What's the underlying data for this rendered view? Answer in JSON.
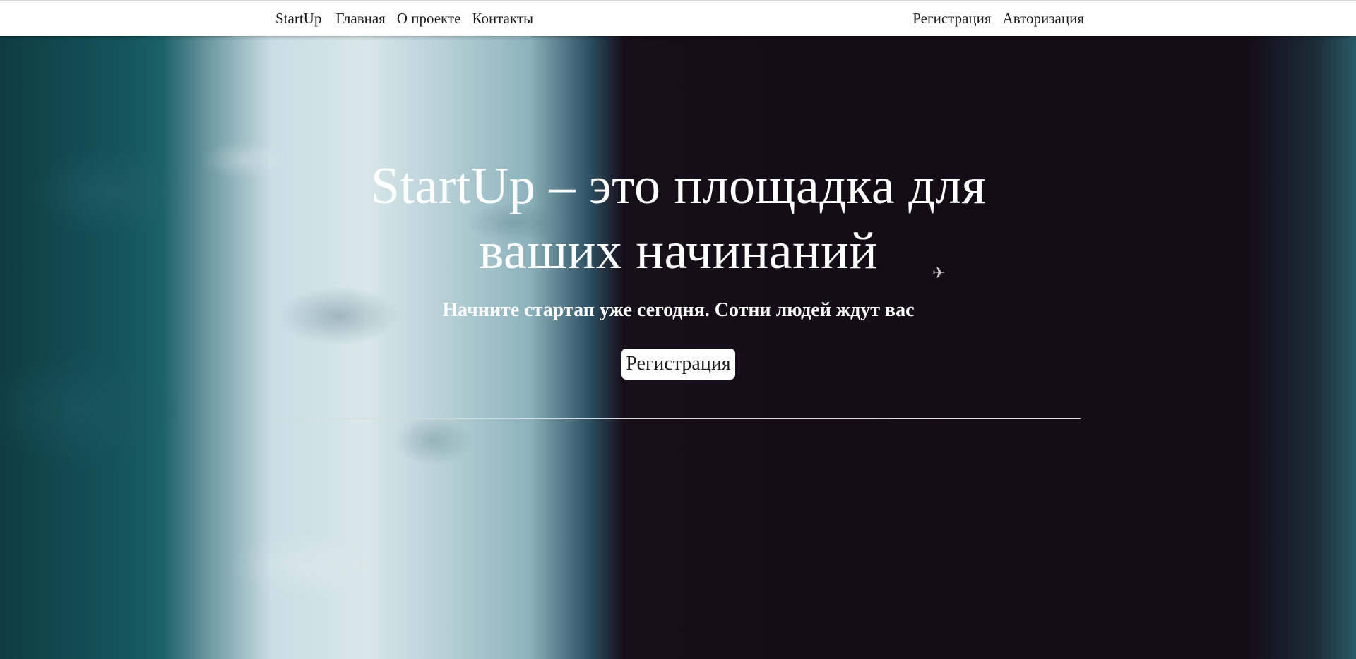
{
  "navbar": {
    "brand": "StartUp",
    "links": [
      "Главная",
      "О проекте",
      "Контакты"
    ],
    "auth_links": [
      "Регистрация",
      "Авторизация"
    ]
  },
  "hero": {
    "title": "StartUp – это площадка для ваших начинаний",
    "subtitle": "Начните стартап уже сегодня. Сотни людей ждут вас",
    "button_label": "Регистрация"
  },
  "icons": {
    "bird": "bird-icon"
  },
  "colors": {
    "navbar_bg": "#ffffff",
    "text_dark": "#1d1d1d",
    "hero_text": "#ffffff",
    "ocean": "#14545b",
    "sand": "#120c16"
  }
}
